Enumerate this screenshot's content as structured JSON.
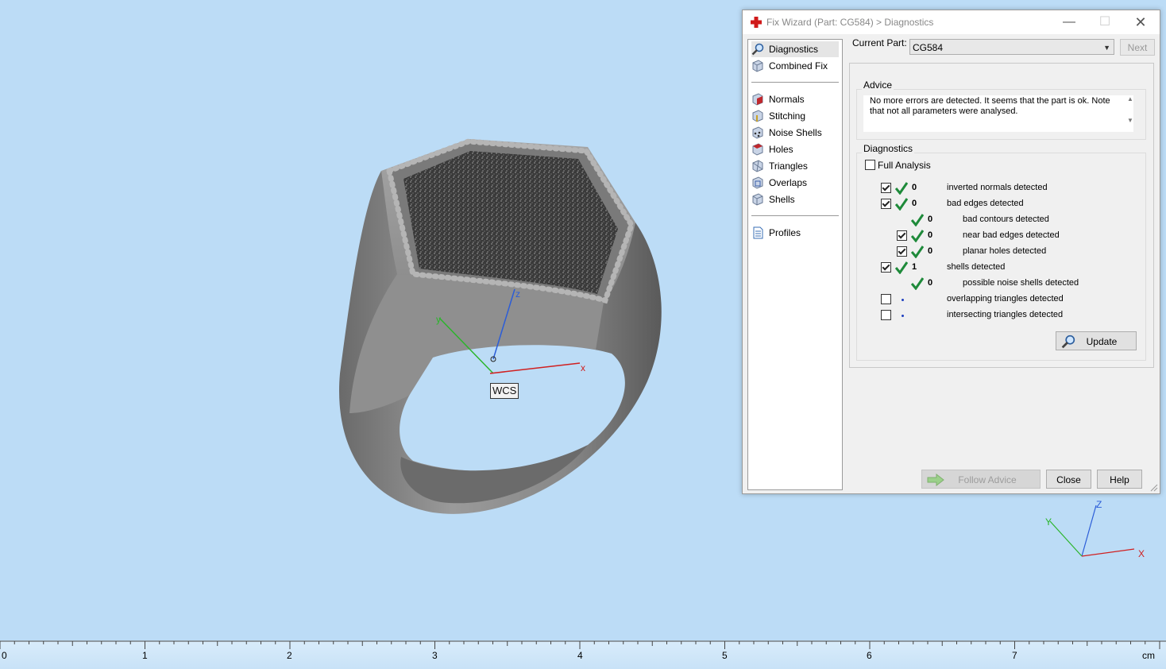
{
  "viewport": {
    "wcs_label": "WCS",
    "axis_x": "x",
    "axis_y": "y",
    "axis_z": "z",
    "mini_axis_x": "X",
    "mini_axis_y": "Y",
    "mini_axis_z": "Z"
  },
  "ruler": {
    "ticks": [
      "0",
      "1",
      "2",
      "3",
      "4",
      "5",
      "6",
      "7"
    ],
    "unit": "cm"
  },
  "dialog": {
    "title": "Fix Wizard (Part: CG584) > Diagnostics",
    "nav": {
      "top": [
        {
          "label": "Diagnostics",
          "icon": "magnifier-icon",
          "selected": true
        },
        {
          "label": "Combined Fix",
          "icon": "cube-icon"
        }
      ],
      "middle": [
        {
          "label": "Normals",
          "icon": "normals-icon"
        },
        {
          "label": "Stitching",
          "icon": "stitching-icon"
        },
        {
          "label": "Noise Shells",
          "icon": "noise-shells-icon"
        },
        {
          "label": "Holes",
          "icon": "holes-icon"
        },
        {
          "label": "Triangles",
          "icon": "triangles-icon"
        },
        {
          "label": "Overlaps",
          "icon": "overlaps-icon"
        },
        {
          "label": "Shells",
          "icon": "shells-icon"
        }
      ],
      "bottom": [
        {
          "label": "Profiles",
          "icon": "document-icon"
        }
      ]
    },
    "current_part_label": "Current Part:",
    "current_part_value": "CG584",
    "next_label": "Next",
    "advice": {
      "title": "Advice",
      "text": "No more errors are detected. It seems that the part is ok. Note that not all parameters were analysed."
    },
    "diagnostics": {
      "title": "Diagnostics",
      "full_analysis_label": "Full Analysis",
      "rows": [
        {
          "checkbox": true,
          "status": "ok",
          "count": "0",
          "label": "inverted normals detected",
          "indent": 0
        },
        {
          "checkbox": true,
          "status": "ok",
          "count": "0",
          "label": "bad edges detected",
          "indent": 0
        },
        {
          "checkbox": null,
          "status": "ok",
          "count": "0",
          "label": "bad contours detected",
          "indent": 1
        },
        {
          "checkbox": true,
          "status": "ok",
          "count": "0",
          "label": "near bad edges detected",
          "indent": 1
        },
        {
          "checkbox": true,
          "status": "ok",
          "count": "0",
          "label": "planar holes detected",
          "indent": 1
        },
        {
          "checkbox": true,
          "status": "ok",
          "count": "1",
          "label": "shells detected",
          "indent": 0
        },
        {
          "checkbox": null,
          "status": "ok",
          "count": "0",
          "label": "possible noise shells detected",
          "indent": 1
        },
        {
          "checkbox": false,
          "status": "dot",
          "count": "",
          "label": "overlapping triangles detected",
          "indent": 0
        },
        {
          "checkbox": false,
          "status": "dot",
          "count": "",
          "label": "intersecting triangles detected",
          "indent": 0
        }
      ],
      "update_label": "Update"
    },
    "buttons": {
      "follow_advice": "Follow Advice",
      "close": "Close",
      "help": "Help"
    },
    "colors": {
      "check_green": "#1e8a3a",
      "dot_blue": "#1e3fbf",
      "viewport_bg": "#bcdcf6"
    }
  }
}
